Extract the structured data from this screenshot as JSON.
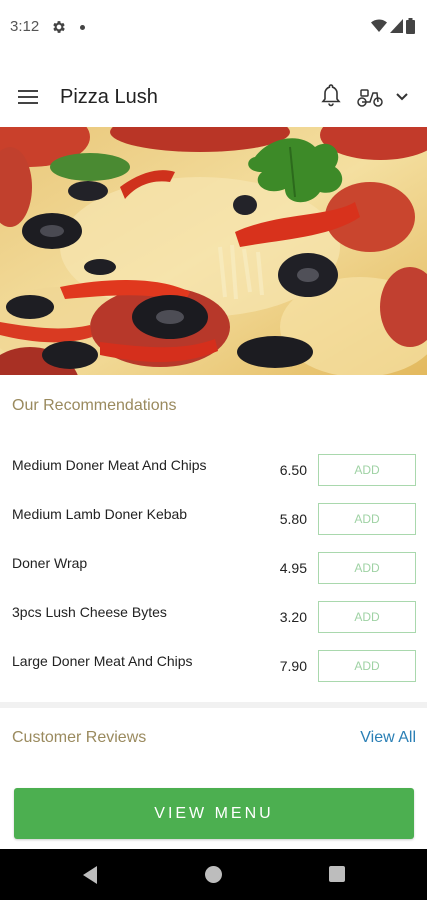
{
  "status_bar": {
    "time": "3:12",
    "icons": [
      "gear-icon",
      "notification-dot",
      "wifi-icon",
      "signal-icon",
      "battery-icon"
    ]
  },
  "app_bar": {
    "title": "Pizza Lush",
    "icons": [
      "hamburger-menu-icon",
      "bell-icon",
      "delivery-scooter-icon",
      "chevron-down-icon"
    ]
  },
  "hero": {
    "image": "pizza-photo",
    "colors": {
      "cheese": "#f2dc8e",
      "pepperoni": "#c8452f",
      "olive": "#1e1e22",
      "parsley": "#3f8b2a"
    }
  },
  "recommendations": {
    "title": "Our Recommendations",
    "items": [
      {
        "name": "Medium Doner Meat And Chips",
        "price": "6.50",
        "add_label": "ADD"
      },
      {
        "name": "Medium Lamb Doner Kebab",
        "price": "5.80",
        "add_label": "ADD"
      },
      {
        "name": "Doner Wrap",
        "price": "4.95",
        "add_label": "ADD"
      },
      {
        "name": "3pcs Lush Cheese Bytes",
        "price": "3.20",
        "add_label": "ADD"
      },
      {
        "name": "Large Doner Meat And Chips",
        "price": "7.90",
        "add_label": "ADD"
      }
    ]
  },
  "reviews": {
    "title": "Customer Reviews",
    "view_all_label": "View All"
  },
  "cta": {
    "label": "VIEW MENU"
  },
  "colors": {
    "accent_green": "#4caf50",
    "section_title": "#9a8a5e",
    "link_blue": "#2a7fb5",
    "add_border": "#a9d8ad"
  },
  "nav_bar": {
    "icons": [
      "back-icon",
      "home-icon",
      "recents-icon"
    ]
  }
}
